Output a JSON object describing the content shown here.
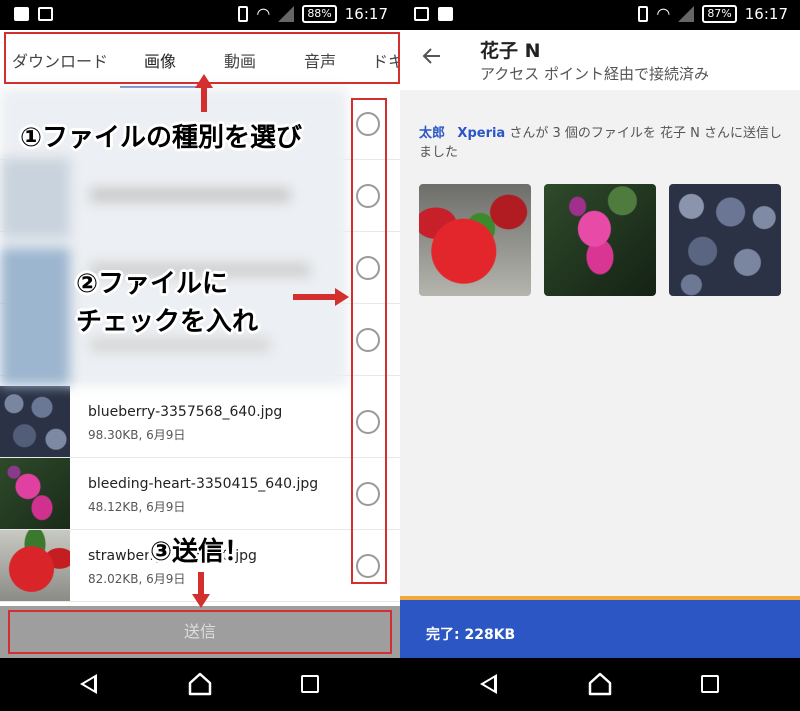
{
  "left": {
    "status": {
      "battery": "88%",
      "time": "16:17"
    },
    "tabs": [
      "ダウンロード",
      "画像",
      "動画",
      "音声",
      "ドキ"
    ],
    "active_tab": "画像",
    "files": [
      {
        "name": "blueberry-3357568_640.jpg",
        "meta": "98.30KB, 6月9日",
        "thumb": "blueberry"
      },
      {
        "name": "bleeding-heart-3350415_640.jpg",
        "meta": "48.12KB, 6月9日",
        "thumb": "bleeding-heart"
      },
      {
        "name": "strawberry-3355640.jpg",
        "meta": "82.02KB, 6月9日",
        "thumb": "strawberry"
      }
    ],
    "send_label": "送信"
  },
  "annotations": {
    "step1": "①ファイルの種別を選び",
    "step2_line1": "②ファイルに",
    "step2_line2": "チェックを入れ",
    "step3": "③送信！"
  },
  "right": {
    "status": {
      "battery": "87%",
      "time": "16:17"
    },
    "peer_name": "花子 N",
    "peer_status": "アクセス ポイント経由で接続済み",
    "message": {
      "sender": "太郎",
      "device": "Xperia",
      "text": "さんが 3 個のファイルを 花子 N さんに送信しました"
    },
    "images": [
      "strawberry",
      "bleeding-heart",
      "blueberry"
    ],
    "complete": "完了: 228KB"
  },
  "colors": {
    "accent": "#3f51b5",
    "annotation": "#d32f2f",
    "complete_bar": "#2b56c3",
    "progress": "#f2a93b"
  }
}
